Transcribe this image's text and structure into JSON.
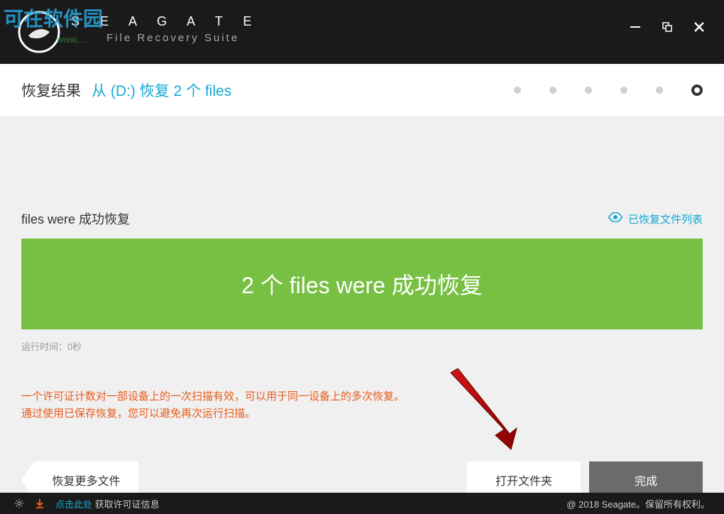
{
  "watermark": {
    "text": "可在软件园",
    "url": "www...."
  },
  "brand": {
    "name": "S E A G A T E",
    "product": "File Recovery Suite"
  },
  "header": {
    "result_label": "恢复结果",
    "drive_info": "从 (D:)  恢复 2 个 files"
  },
  "progress": {
    "total": 6,
    "active": 6
  },
  "main": {
    "section_title": "files were 成功恢复",
    "recovered_list_link": "已恢复文件列表",
    "banner": "2 个 files were 成功恢复",
    "runtime": "运行时间：0秒",
    "license_line1": "一个许可证计数对一部设备上的一次扫描有效，可以用于同一设备上的多次恢复。",
    "license_line2": "通过使用已保存恢复，您可以避免再次运行扫描。"
  },
  "buttons": {
    "back": "恢复更多文件",
    "open": "打开文件夹",
    "done": "完成"
  },
  "footer": {
    "click_here": "点击此处",
    "license_info": " 获取许可证信息",
    "copyright": "@ 2018 Seagate。保留所有权利。"
  },
  "colors": {
    "accent_blue": "#14a8d4",
    "success_green": "#77c043",
    "warning_orange": "#e85b1a",
    "dark_bg": "#1a1a1a"
  }
}
